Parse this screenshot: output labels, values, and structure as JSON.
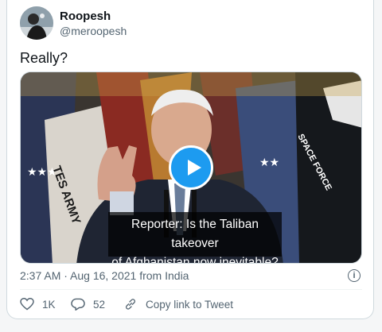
{
  "user": {
    "name": "Roopesh",
    "handle": "@meroopesh"
  },
  "tweet": {
    "text": "Really?"
  },
  "media": {
    "caption_line1": "Reporter: Is the Taliban takeover",
    "caption_line2": "of Afghanistan now inevitable?",
    "flag_text_left": "TES ARMY",
    "flag_text_right": "SPACE FORCE",
    "play_icon": "play-icon"
  },
  "meta": {
    "timestamp": "2:37 AM · Aug 16, 2021 from India",
    "info_icon": "info-icon"
  },
  "actions": {
    "likes": "1K",
    "replies": "52",
    "copy_link": "Copy link to Tweet"
  },
  "colors": {
    "accent": "#1d9bf0",
    "secondary_text": "#536471",
    "border": "#cfd9de"
  }
}
